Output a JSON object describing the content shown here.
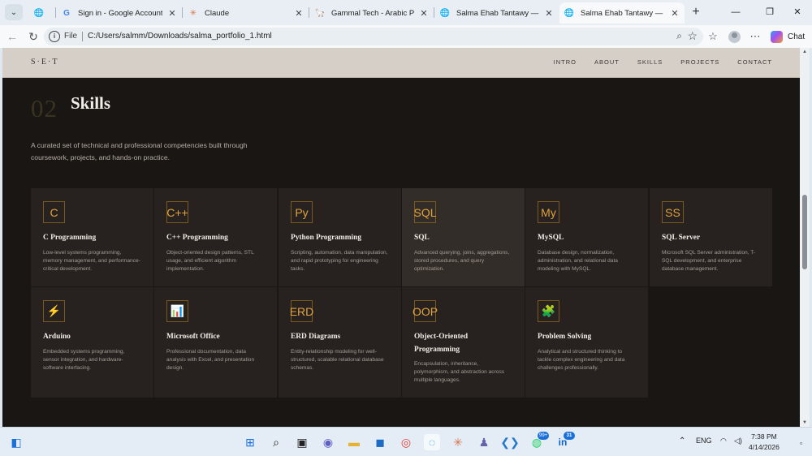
{
  "browser": {
    "tabs": [
      {
        "title": "",
        "icon": "globe-icon"
      },
      {
        "title": "Sign in - Google Accounts",
        "icon": "google-icon"
      },
      {
        "title": "Claude",
        "icon": "claude-icon"
      },
      {
        "title": "Gammal Tech - Arabic Progra",
        "icon": "gammal-icon"
      },
      {
        "title": "Salma Ehab Tantawy — Portfo",
        "icon": "globe-icon"
      },
      {
        "title": "Salma Ehab Tantawy — Portfo",
        "icon": "globe-icon"
      }
    ],
    "address": {
      "scheme": "File",
      "url": "C:/Users/salmm/Downloads/salma_portfolio_1.html"
    },
    "chat_label": "Chat"
  },
  "site": {
    "logo": "S·E·T",
    "nav": [
      "INTRO",
      "ABOUT",
      "SKILLS",
      "PROJECTS",
      "CONTACT"
    ],
    "section": {
      "number": "02",
      "title": "Skills",
      "description": "A curated set of technical and professional competencies built through coursework, projects, and hands-on practice."
    },
    "skills": [
      {
        "icon": "C",
        "name": "C Programming",
        "desc": "Low-level systems programming, memory management, and performance-critical development."
      },
      {
        "icon": "C++",
        "name": "C++ Programming",
        "desc": "Object-oriented design patterns, STL usage, and efficient algorithm implementation."
      },
      {
        "icon": "Py",
        "name": "Python Programming",
        "desc": "Scripting, automation, data manipulation, and rapid prototyping for engineering tasks."
      },
      {
        "icon": "SQL",
        "name": "SQL",
        "desc": "Advanced querying, joins, aggregations, stored procedures, and query optimization."
      },
      {
        "icon": "My",
        "name": "MySQL",
        "desc": "Database design, normalization, administration, and relational data modeling with MySQL."
      },
      {
        "icon": "SS",
        "name": "SQL Server",
        "desc": "Microsoft SQL Server administration, T-SQL development, and enterprise database management."
      },
      {
        "icon": "⚡",
        "name": "Arduino",
        "desc": "Embedded systems programming, sensor integration, and hardware-software interfacing."
      },
      {
        "icon": "📊",
        "name": "Microsoft Office",
        "desc": "Professional documentation, data analysis with Excel, and presentation design."
      },
      {
        "icon": "ERD",
        "name": "ERD Diagrams",
        "desc": "Entity-relationship modeling for well-structured, scalable relational database schemas."
      },
      {
        "icon": "OOP",
        "name": "Object-Oriented Programming",
        "desc": "Encapsulation, inheritance, polymorphism, and abstraction across multiple languages."
      },
      {
        "icon": "🧩",
        "name": "Problem Solving",
        "desc": "Analytical and structured thinking to tackle complex engineering and data challenges professionally."
      }
    ]
  },
  "taskbar": {
    "badges": {
      "whatsapp": "99+",
      "linkedin": "31"
    },
    "language": "ENG",
    "time": "7:38 PM",
    "date": "4/14/2026"
  },
  "colors": {
    "accent": "#e1a23c",
    "page_bg": "#1a1614",
    "card_bg": "#272220",
    "nav_bg": "#d5cfc8"
  }
}
